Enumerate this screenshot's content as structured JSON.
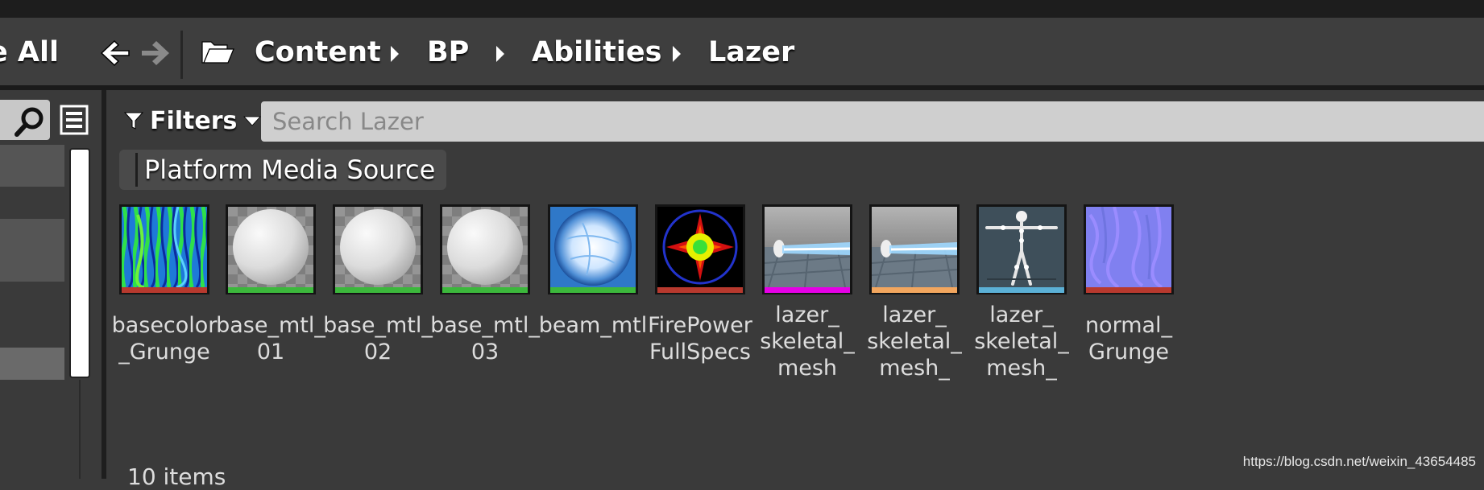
{
  "toolbar": {
    "save_all_label": "e All",
    "breadcrumb": [
      "Content",
      "BP",
      "Abilities",
      "Lazer"
    ],
    "back_icon": "arrow-left-icon",
    "forward_icon": "arrow-right-icon",
    "folder_icon": "folder-open-icon"
  },
  "sources_panel": {
    "search_icon": "search-icon",
    "view_options_icon": "list-view-icon"
  },
  "filters": {
    "label": "Filters",
    "icon": "funnel-icon"
  },
  "search": {
    "placeholder": "Search Lazer"
  },
  "active_filter_chip": "Platform Media Source",
  "assets": [
    {
      "name": "basecolor _Grunge",
      "color_bar": "#b8392e"
    },
    {
      "name": "base_mtl_ 01",
      "color_bar": "#3cb83c"
    },
    {
      "name": "base_mtl_ 02",
      "color_bar": "#3cb83c"
    },
    {
      "name": "base_mtl_ 03",
      "color_bar": "#3cb83c"
    },
    {
      "name": "beam_mtl",
      "color_bar": "#3cb83c"
    },
    {
      "name": "FirePower FullSpecs",
      "color_bar": "#b8392e"
    },
    {
      "name": "lazer_ skeletal_ mesh",
      "color_bar": "#e600e6"
    },
    {
      "name": "lazer_ skeletal_ mesh_",
      "color_bar": "#f2a65e"
    },
    {
      "name": "lazer_ skeletal_ mesh_",
      "color_bar": "#5bb0d6"
    },
    {
      "name": "normal_ Grunge",
      "color_bar": "#b8392e"
    }
  ],
  "status": {
    "item_count": "10 items"
  },
  "watermark": "https://blog.csdn.net/weixin_43654485"
}
